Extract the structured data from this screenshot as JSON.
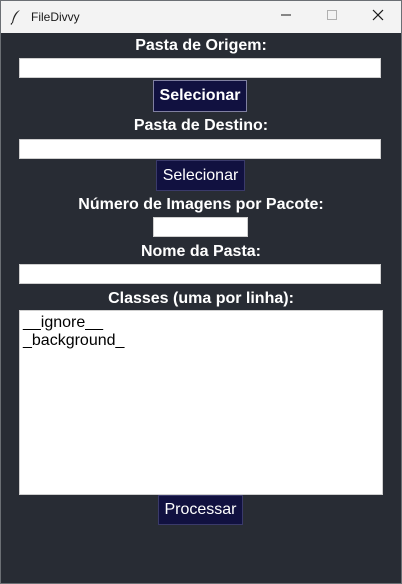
{
  "window": {
    "title": "FileDivvy"
  },
  "form": {
    "source_label": "Pasta de Origem:",
    "source_value": "",
    "source_button": "Selecionar",
    "dest_label": "Pasta de Destino:",
    "dest_value": "",
    "dest_button": "Selecionar",
    "count_label": "Número de Imagens por Pacote:",
    "count_value": "",
    "folder_name_label": "Nome da Pasta:",
    "folder_name_value": "",
    "classes_label": "Classes (uma por linha):",
    "classes_lines": [
      "__ignore__",
      "_background_"
    ],
    "process_button": "Processar"
  },
  "icons": {
    "app": "feather-icon",
    "minimize": "minimize-icon",
    "maximize": "maximize-icon",
    "close": "close-icon"
  },
  "colors": {
    "background": "#282c34",
    "button": "#111140",
    "titlebar": "#f3f3f3"
  }
}
